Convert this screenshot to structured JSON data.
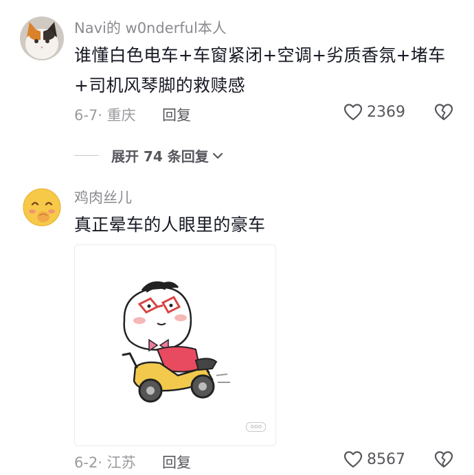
{
  "comments": [
    {
      "username": "Navi的 w0nderful本人",
      "text_line1": "谁懂白色电车+车窗紧闭+空调+劣质香氛+堵车",
      "text_line2": "+司机风琴脚的救赎感",
      "date_location": "6-7· 重庆",
      "reply_label": "回复",
      "likes": "2369"
    },
    {
      "username": "鸡肉丝儿",
      "text_line1": "真正晕车的人眼里的豪车",
      "date_location": "6-2· 江苏",
      "reply_label": "回复",
      "likes": "8567",
      "image_watermark": "ooo"
    }
  ],
  "expand_replies": {
    "label": "展开 74 条回复"
  },
  "icons": {
    "like": "heart-outline-icon",
    "dislike": "broken-heart-icon",
    "expand": "chevron-down-icon"
  },
  "colors": {
    "text": "#161823",
    "secondary": "#8a8a8f",
    "meta": "#9a9a9f",
    "action": "#56565c"
  }
}
